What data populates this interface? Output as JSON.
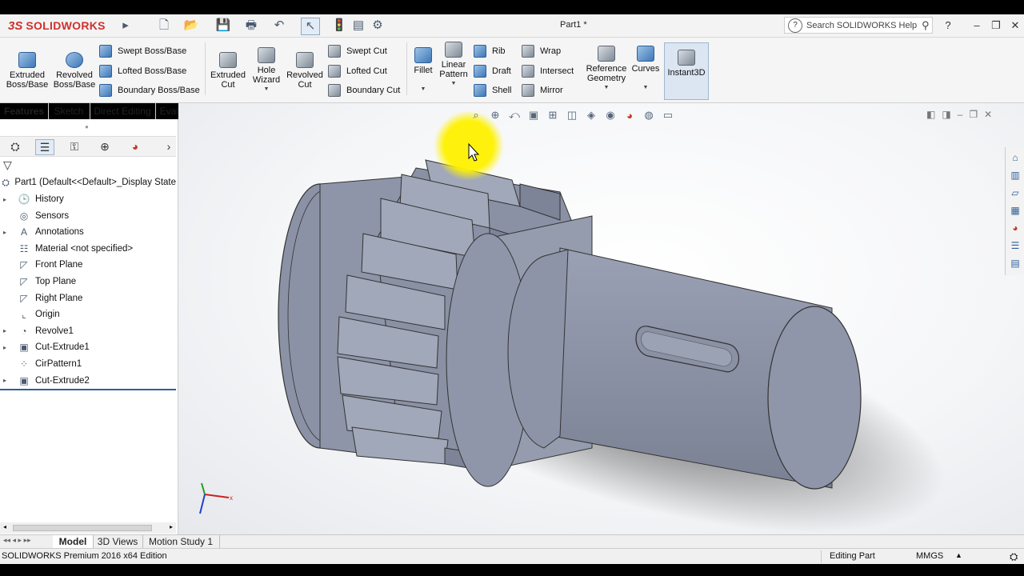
{
  "app": {
    "logo_ds": "3S",
    "logo_text": "SOLIDWORKS",
    "document_title": "Part1 *",
    "help_search_placeholder": "Search SOLIDWORKS Help"
  },
  "toolbar": {
    "features": {
      "extruded_boss": "Extruded Boss/Base",
      "revolved_boss": "Revolved Boss/Base",
      "swept_boss": "Swept Boss/Base",
      "lofted_boss": "Lofted Boss/Base",
      "boundary_boss": "Boundary Boss/Base",
      "extruded_cut": "Extruded Cut",
      "hole_wizard": "Hole Wizard",
      "revolved_cut": "Revolved Cut",
      "swept_cut": "Swept Cut",
      "lofted_cut": "Lofted Cut",
      "boundary_cut": "Boundary Cut",
      "fillet": "Fillet",
      "linear_pattern": "Linear Pattern",
      "rib": "Rib",
      "draft": "Draft",
      "shell": "Shell",
      "wrap": "Wrap",
      "intersect": "Intersect",
      "mirror": "Mirror",
      "reference_geometry": "Reference Geometry",
      "curves": "Curves",
      "instant3d": "Instant3D"
    }
  },
  "tabs": [
    "Features",
    "Sketch",
    "Direct Editing",
    "Evaluate"
  ],
  "feature_tree": {
    "root": "Part1  (Default<<Default>_Display State",
    "items": [
      {
        "label": "History",
        "icon": "history-icon"
      },
      {
        "label": "Sensors",
        "icon": "sensors-icon"
      },
      {
        "label": "Annotations",
        "icon": "annotations-icon"
      },
      {
        "label": "Material <not specified>",
        "icon": "material-icon"
      },
      {
        "label": "Front Plane",
        "icon": "plane-icon"
      },
      {
        "label": "Top Plane",
        "icon": "plane-icon"
      },
      {
        "label": "Right Plane",
        "icon": "plane-icon"
      },
      {
        "label": "Origin",
        "icon": "origin-icon"
      },
      {
        "label": "Revolve1",
        "icon": "revolve-icon"
      },
      {
        "label": "Cut-Extrude1",
        "icon": "cut-extrude-icon"
      },
      {
        "label": "CirPattern1",
        "icon": "circular-pattern-icon"
      },
      {
        "label": "Cut-Extrude2",
        "icon": "cut-extrude-icon"
      }
    ]
  },
  "bottom_tabs": [
    "Model",
    "3D Views",
    "Motion Study 1"
  ],
  "status": {
    "edition": "SOLIDWORKS Premium 2016 x64 Edition",
    "mode": "Editing Part",
    "units": "MMGS"
  },
  "colors": {
    "accent": "#2d5f99",
    "logo_red": "#d0312d",
    "model_grey": "#8e95a6",
    "cursor_highlight": "#fff200"
  }
}
